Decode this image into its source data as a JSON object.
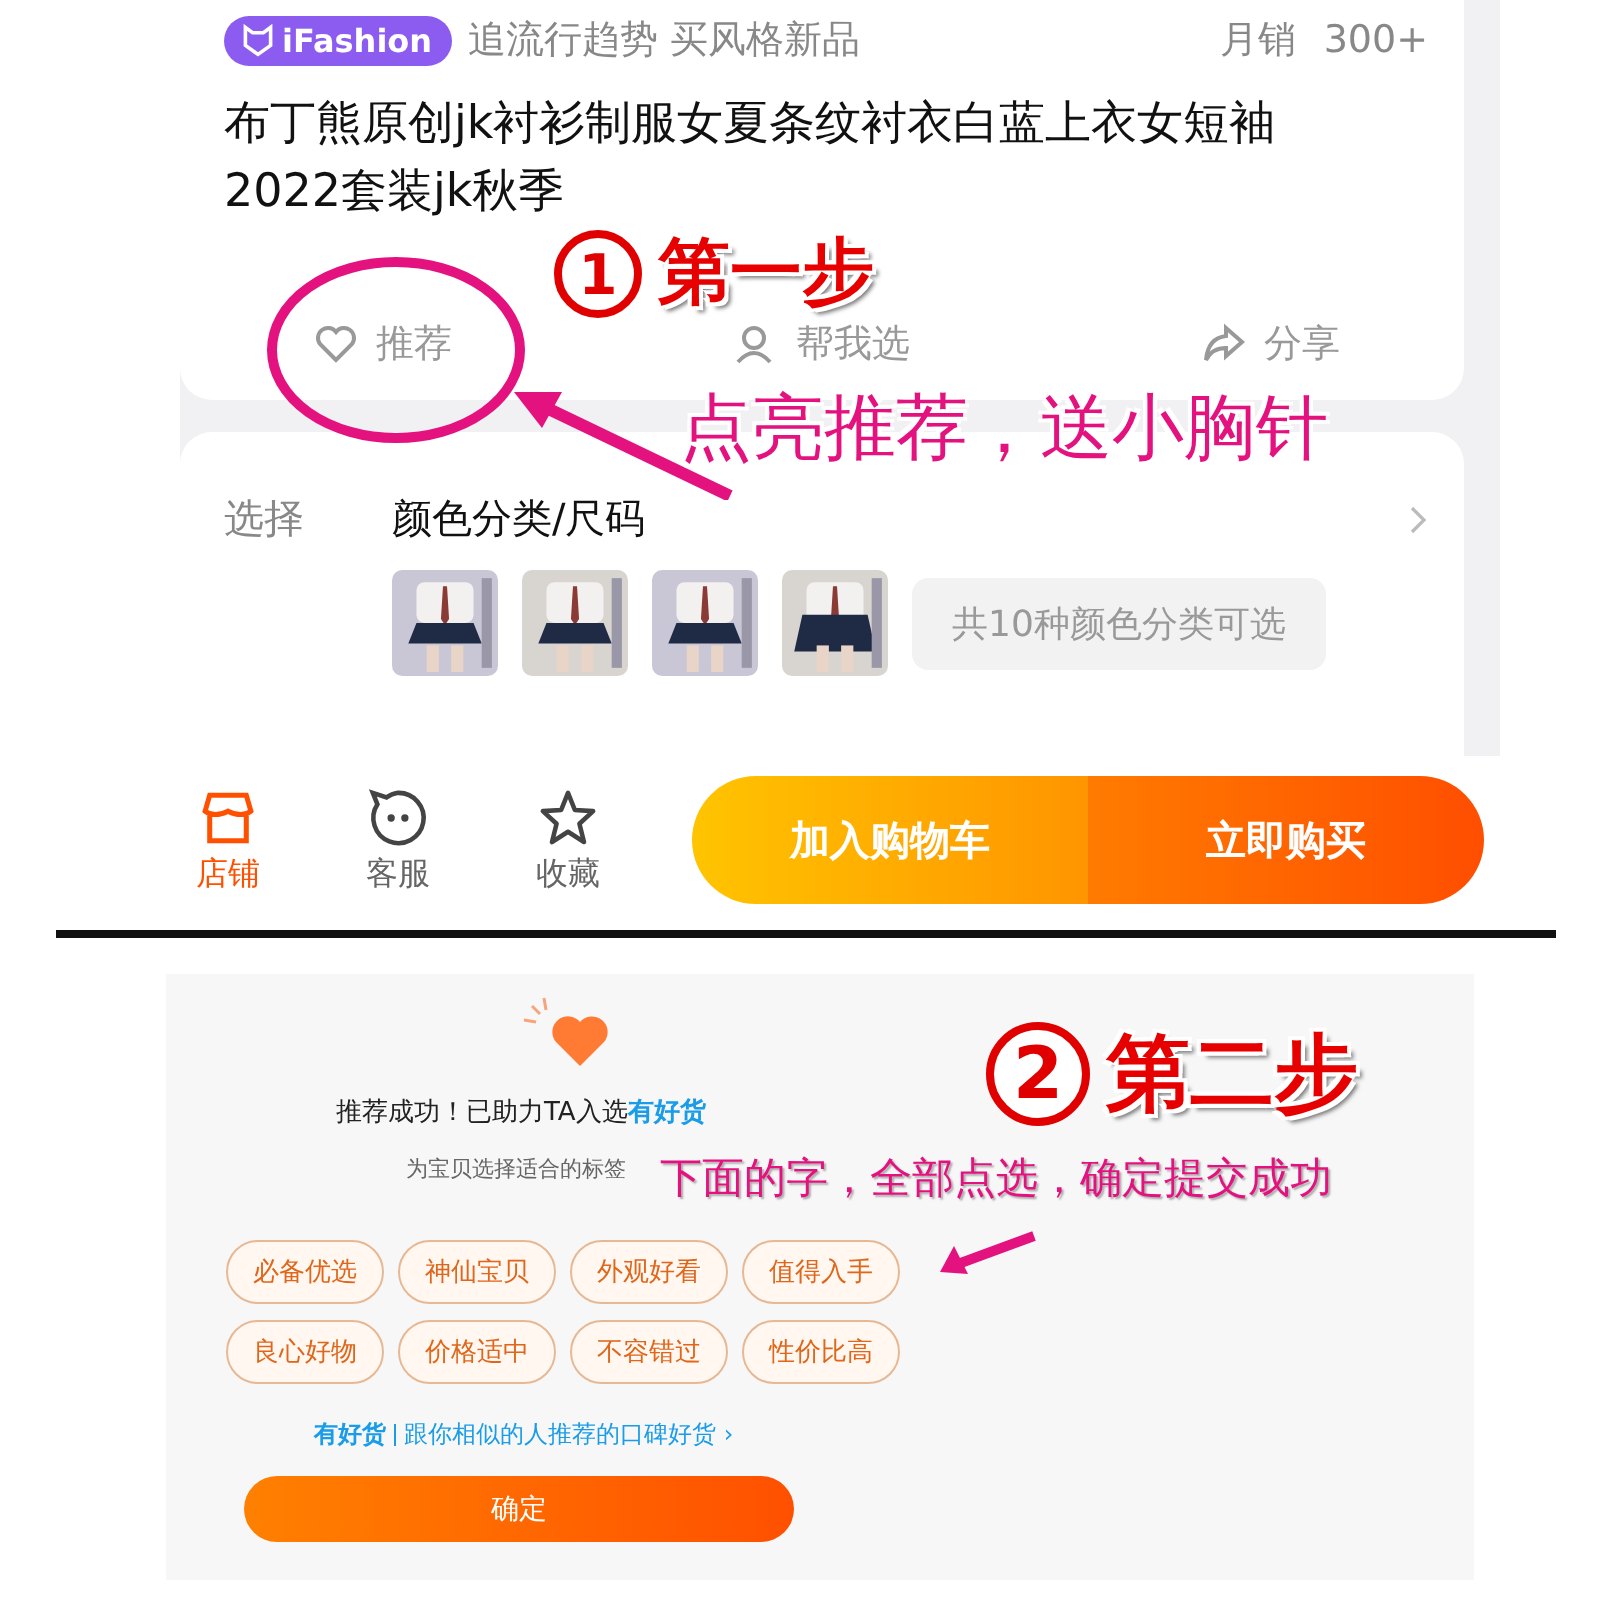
{
  "product_card": {
    "badge": "iFashion",
    "slogan": "追流行趋势 买风格新品",
    "sales_label": "月销",
    "sales_count": "300+",
    "title": "布丁熊原创jk衬衫制服女夏条纹衬衣白蓝上衣女短袖2022套装jk秋季",
    "actions": [
      {
        "kind": "heart",
        "label": "推荐"
      },
      {
        "kind": "person",
        "label": "帮我选"
      },
      {
        "kind": "share",
        "label": "分享"
      }
    ]
  },
  "sku_card": {
    "label": "选择",
    "title": "颜色分类/尺码",
    "more": "共10种颜色分类可选"
  },
  "bottom_bar": {
    "icons": [
      {
        "kind": "shop",
        "label": "店铺"
      },
      {
        "kind": "service",
        "label": "客服"
      },
      {
        "kind": "star",
        "label": "收藏"
      }
    ],
    "buttons": [
      {
        "kind": "cart",
        "label": "加入购物车"
      },
      {
        "kind": "buy",
        "label": "立即购买"
      }
    ]
  },
  "dialog": {
    "title": "推荐成功！已助力TA入选",
    "title_link": "有好货",
    "subtitle": "为宝贝选择适合的标签",
    "tags": [
      {
        "label": "必备优选",
        "selected": false
      },
      {
        "label": "神仙宝贝",
        "selected": false
      },
      {
        "label": "外观好看",
        "selected": false
      },
      {
        "label": "值得入手",
        "selected": false
      },
      {
        "label": "良心好物",
        "selected": false
      },
      {
        "label": "价格适中",
        "selected": false
      },
      {
        "label": "不容错过",
        "selected": false
      },
      {
        "label": "性价比高",
        "selected": false
      }
    ],
    "footer_brand": "有好货",
    "footer_text": "跟你相似的人推荐的口碑好货 ›",
    "confirm": "确定"
  },
  "annotations": [
    {
      "number": "1",
      "title": "第一步",
      "note": "点亮推荐，送小胸针"
    },
    {
      "number": "2",
      "title": "第二步",
      "note": "下面的字，全部点选，确定提交成功"
    }
  ]
}
